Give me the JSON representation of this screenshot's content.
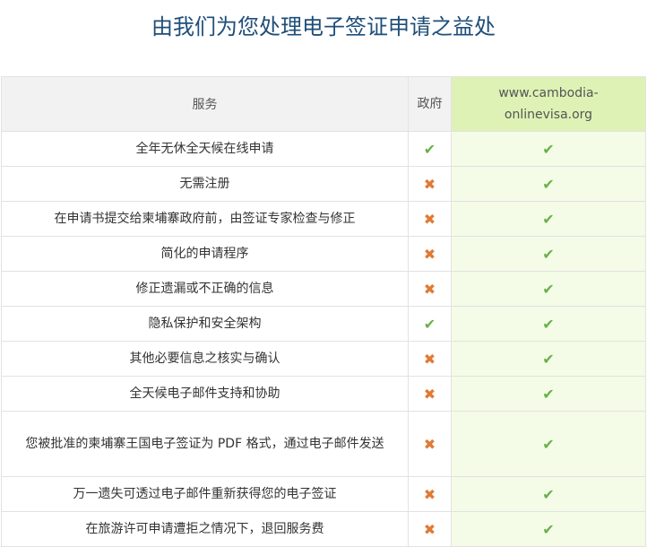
{
  "title": "由我们为您处理电子签证申请之益处",
  "headers": {
    "service": "服务",
    "gov": "政府",
    "site": "www.cambodia-onlinevisa.org"
  },
  "icons": {
    "check": "✔",
    "cross": "✖"
  },
  "colors": {
    "check": "#6ab04c",
    "cross": "#e07a34",
    "title": "#1f4e79",
    "site_header_bg": "#ddf2b4"
  },
  "rows": [
    {
      "label": "全年无休全天候在线申请",
      "gov": "check",
      "site": "check"
    },
    {
      "label": "无需注册",
      "gov": "cross",
      "site": "check"
    },
    {
      "label": "在申请书提交给柬埔寨政府前，由签证专家检查与修正",
      "gov": "cross",
      "site": "check"
    },
    {
      "label": "简化的申请程序",
      "gov": "cross",
      "site": "check"
    },
    {
      "label": "修正遗漏或不正确的信息",
      "gov": "cross",
      "site": "check"
    },
    {
      "label": "隐私保护和安全架构",
      "gov": "check",
      "site": "check"
    },
    {
      "label": "其他必要信息之核实与确认",
      "gov": "cross",
      "site": "check"
    },
    {
      "label": "全天候电子邮件支持和协助",
      "gov": "cross",
      "site": "check"
    },
    {
      "label": "您被批准的柬埔寨王国电子签证为 PDF 格式，通过电子邮件发送",
      "gov": "cross",
      "site": "check"
    },
    {
      "label": "万一遗失可透过电子邮件重新获得您的电子签证",
      "gov": "cross",
      "site": "check"
    },
    {
      "label": "在旅游许可申请遭拒之情况下，退回服务费",
      "gov": "cross",
      "site": "check"
    }
  ]
}
